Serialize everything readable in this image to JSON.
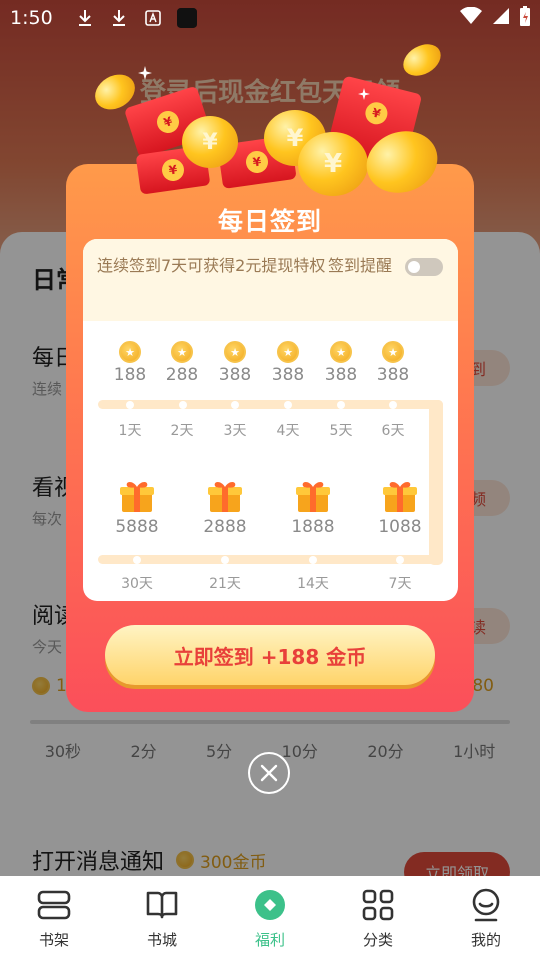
{
  "status_bar": {
    "time": "1:50"
  },
  "background": {
    "banner": "登录后现金红包天天领",
    "section_title": "日常",
    "rows": [
      {
        "title": "每日",
        "sub": "连续",
        "button": "签到"
      },
      {
        "title": "看视",
        "sub": "每次",
        "button": "视频"
      },
      {
        "title": "阅读",
        "sub": "今天",
        "button": "阅读"
      }
    ],
    "reading_coin_left": "1",
    "reading_coin_right": "80",
    "reading_milestones": [
      "30秒",
      "2分",
      "5分",
      "10分",
      "20分",
      "1小时"
    ],
    "notify_title": "打开消息通知",
    "notify_coins": "300金币",
    "notify_button": "立即领取"
  },
  "modal": {
    "title": "每日签到",
    "description": "连续签到7天可获得2元提现特权",
    "remind_label": "签到提醒",
    "remind_on": false,
    "week_rewards": [
      {
        "amount": "188",
        "day": "1天"
      },
      {
        "amount": "288",
        "day": "2天"
      },
      {
        "amount": "388",
        "day": "3天"
      },
      {
        "amount": "388",
        "day": "4天"
      },
      {
        "amount": "388",
        "day": "5天"
      },
      {
        "amount": "388",
        "day": "6天"
      }
    ],
    "big_rewards": [
      {
        "amount": "5888",
        "day": "30天"
      },
      {
        "amount": "2888",
        "day": "21天"
      },
      {
        "amount": "1888",
        "day": "14天"
      },
      {
        "amount": "1088",
        "day": "7天"
      }
    ],
    "signin_button": "立即签到 +188 金币"
  },
  "nav": {
    "items": [
      {
        "label": "书架",
        "icon": "bookshelf-icon",
        "active": false
      },
      {
        "label": "书城",
        "icon": "book-icon",
        "active": false
      },
      {
        "label": "福利",
        "icon": "gift-diamond-icon",
        "active": true
      },
      {
        "label": "分类",
        "icon": "grid-icon",
        "active": false
      },
      {
        "label": "我的",
        "icon": "profile-icon",
        "active": false
      }
    ],
    "active_color": "#3cc18a"
  },
  "colors": {
    "modal_top": "#ff9a4a",
    "modal_bottom": "#fb4f5a",
    "button_text": "#e8403a",
    "accent_red": "#e24a3b"
  }
}
